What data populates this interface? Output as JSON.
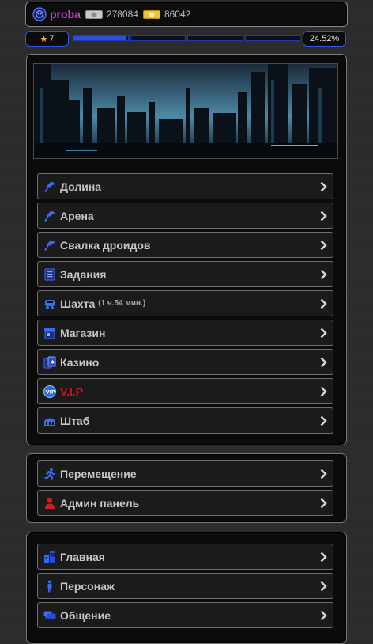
{
  "player": {
    "name": "proba",
    "silver": "278084",
    "gold": "86042"
  },
  "level": {
    "value": "7",
    "percent": "24.52%",
    "progress": 0.2452
  },
  "main_menu": [
    {
      "label": "Долина",
      "icon": "gun-icon"
    },
    {
      "label": "Арена",
      "icon": "gun-icon"
    },
    {
      "label": "Свалка дроидов",
      "icon": "gun-icon"
    },
    {
      "label": "Задания",
      "icon": "document-icon"
    },
    {
      "label": "Шахта",
      "sub": "(1 ч.54 мин.)",
      "icon": "minecart-icon"
    },
    {
      "label": "Магазин",
      "icon": "shop-icon"
    },
    {
      "label": "Казино",
      "icon": "cards-icon"
    },
    {
      "label": "V.I.P",
      "icon": "vip-icon"
    },
    {
      "label": "Штаб",
      "icon": "headquarters-icon"
    }
  ],
  "nav_menu": [
    {
      "label": "Перемещение",
      "icon": "running-man-icon"
    },
    {
      "label": "Админ панель",
      "icon": "admin-icon"
    }
  ],
  "bottom_menu": [
    {
      "label": "Главная",
      "icon": "buildings-icon"
    },
    {
      "label": "Персонаж",
      "icon": "person-icon"
    },
    {
      "label": "Общение",
      "icon": "chat-icon"
    }
  ],
  "colors": {
    "accent": "#2e54e8",
    "player_name": "#c73fd1",
    "vip": "#c9141a"
  }
}
